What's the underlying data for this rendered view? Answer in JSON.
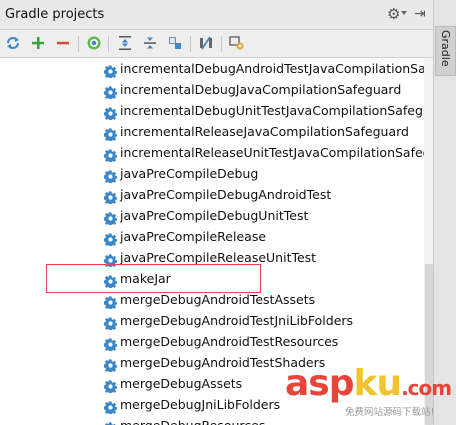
{
  "panel": {
    "title": "Gradle projects",
    "side_tab_label": "Gradle"
  },
  "toolbar": {
    "buttons": [
      {
        "name": "refresh-all-projects",
        "icon": "refresh-icon"
      },
      {
        "name": "add-project",
        "icon": "plus-icon"
      },
      {
        "name": "remove-project",
        "icon": "minus-icon"
      },
      {
        "name": "execute-task",
        "icon": "run-target-icon"
      },
      {
        "name": "expand-all",
        "icon": "expand-all-icon"
      },
      {
        "name": "collapse-all",
        "icon": "collapse-all-icon"
      },
      {
        "name": "attach-project",
        "icon": "attach-icon"
      },
      {
        "name": "toggle-offline",
        "icon": "offline-icon"
      },
      {
        "name": "gradle-settings",
        "icon": "settings-icon"
      }
    ]
  },
  "tasks": [
    {
      "label": "incrementalDebugAndroidTestJavaCompilationSafeguard"
    },
    {
      "label": "incrementalDebugJavaCompilationSafeguard"
    },
    {
      "label": "incrementalDebugUnitTestJavaCompilationSafeguard"
    },
    {
      "label": "incrementalReleaseJavaCompilationSafeguard"
    },
    {
      "label": "incrementalReleaseUnitTestJavaCompilationSafeguard"
    },
    {
      "label": "javaPreCompileDebug"
    },
    {
      "label": "javaPreCompileDebugAndroidTest"
    },
    {
      "label": "javaPreCompileDebugUnitTest"
    },
    {
      "label": "javaPreCompileRelease"
    },
    {
      "label": "javaPreCompileReleaseUnitTest"
    },
    {
      "label": "makeJar"
    },
    {
      "label": "mergeDebugAndroidTestAssets"
    },
    {
      "label": "mergeDebugAndroidTestJniLibFolders"
    },
    {
      "label": "mergeDebugAndroidTestResources"
    },
    {
      "label": "mergeDebugAndroidTestShaders"
    },
    {
      "label": "mergeDebugAssets"
    },
    {
      "label": "mergeDebugJniLibFolders"
    },
    {
      "label": "mergeDebugResources"
    }
  ],
  "highlighted_task": "makeJar",
  "watermark": {
    "brand_a": "asp",
    "brand_b": "ku",
    "brand_c": ".com",
    "tagline": "免费网站源码下载站!"
  },
  "colors": {
    "highlight_border": "#e0474c",
    "gear_icon": "#3d87c9",
    "watermark_red": "#e8443a",
    "watermark_yellow": "#f0c431"
  }
}
